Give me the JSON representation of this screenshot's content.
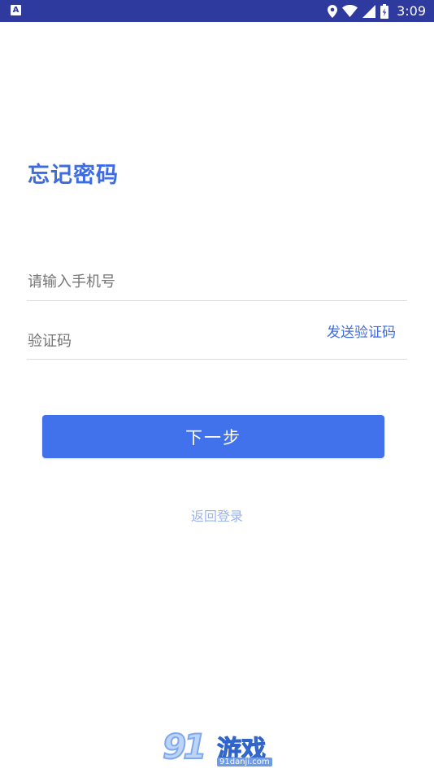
{
  "status_bar": {
    "time": "3:09",
    "left_icon_letter": "A",
    "icons": [
      "location-icon",
      "wifi-icon",
      "signal-icon",
      "battery-charging-icon"
    ]
  },
  "page": {
    "title": "忘记密码"
  },
  "form": {
    "phone_placeholder": "请输入手机号",
    "code_placeholder": "验证码",
    "send_code_label": "发送验证码",
    "next_button": "下一步",
    "back_to_login": "返回登录"
  },
  "watermark": {
    "logo_number": "91",
    "logo_text": "游戏",
    "url": "91danji.com"
  },
  "colors": {
    "status_bar": "#2f3a9e",
    "accent": "#3d6be0",
    "button": "#4271ec",
    "link_light": "#9bb4ee",
    "divider": "#dedede"
  }
}
